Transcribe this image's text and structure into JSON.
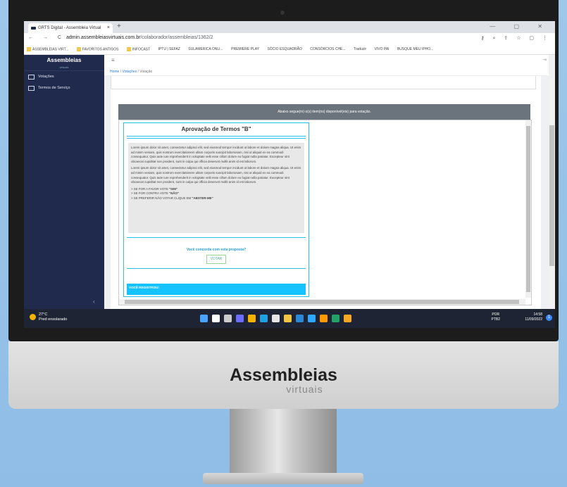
{
  "browser": {
    "tab_title": "GRTS Digital - Assembleia Virtual",
    "tab_close": "×",
    "new_tab": "+",
    "window_controls": "—  ▢  ✕",
    "nav": "← → C",
    "url_domain": "admin.assembleiasvirtuais.com.br",
    "url_path": "/colaborador/assembleias/1362/2",
    "tools": "⚷ ⌕ ⇪ ☆ ▢ ⋮",
    "bookmarks": [
      "ASSEMBLEIAS VIRT...",
      "FAVORITOS ANTIGOS",
      "INFOCAST",
      "IPTU | SEFAZ",
      "SULAMERICA ONLI...",
      "PREMIERE PLAY",
      "SÓCIO ESQUADRÃO",
      "CONSÓRCIOS CHE...",
      "Traduzir",
      "VIVO PAI",
      "BUSQUE MEU IPHO..."
    ]
  },
  "sidebar": {
    "logo": "Assembleias",
    "logo_sub": "virtuais",
    "items": [
      {
        "label": "Votações"
      },
      {
        "label": "Termos de Serviço"
      }
    ],
    "collapse": "‹"
  },
  "topbar": {
    "menu": "≡",
    "logout": "⇥"
  },
  "breadcrumb": {
    "home": "Home",
    "sep": "/",
    "votacoes": "Votações",
    "current": "Votação"
  },
  "notice": "Abaixo segue(m) o(s) item(ns) disponível(eis) para votação.",
  "document": {
    "title": "Aprovação de Termos \"B\"",
    "paragraph1": "Lorem ipsum dolor sit amet, consectetur adipisci elit, sed eiusmod tempor incidunt ut labore et dolore magna aliqua. Ut enim ad minim veniam, quis nostrum exercitationem ullam corporis suscipit laboriosam, nisi ut aliquid ex ea commodi consequatur. Quis aute iure reprehenderit in voluptate velit esse cillum dolore eu fugiat nulla pariatur. Excepteur sint obcaecat cupiditat non proident, sunt in culpa qui officia deserunt mollit anim id est laborum.",
    "paragraph2": "Lorem ipsum dolor sit amet, consectetur adipisci elit, sed eiusmod tempor incidunt ut labore et dolore magna aliqua. Ut enim ad minim veniam, quis nostrum exercitationem ullam corporis suscipit laboriosam, nisi ut aliquid ex ea commodi consequatur. Quis aute iure reprehenderit in voluptate velit esse cillum dolore eu fugiat nulla pariatur. Excepteur sint obcaecat cupiditat non proident, sunt in culpa qui officia deserunt mollit anim id est laborum.",
    "vote_yes_prefix": "> SE FOR A FAVOR VOTE ",
    "vote_yes": "\"SIM\"",
    "vote_no_prefix": "> SE FOR CONTRA VOTE ",
    "vote_no": "\"NÃO\"",
    "vote_abstain_prefix": "> SE PREFERIR NÃO VOTAR CLIQUE EM ",
    "vote_abstain": "\"ABSTER-ME\"",
    "question": "Você concorda com esta proposta?",
    "vote_button": "VOTAR",
    "registered": "VOCÊ REGISTROU:"
  },
  "taskbar": {
    "temp": "27°C",
    "weather": "Pred ensolarado",
    "lang1": "POR",
    "lang2": "PTB2",
    "time": "14:58",
    "date": "11/09/2022",
    "icons": [
      "windows-icon",
      "search-icon",
      "taskview-icon",
      "chat-icon",
      "chrome-icon",
      "edge-icon",
      "store-icon",
      "explorer-icon",
      "mail-icon",
      "photoshop-icon",
      "illustrator-icon",
      "excel-icon",
      "photos-icon"
    ],
    "icon_colors": [
      "#4aa3ff",
      "#ffffff",
      "#cccccc",
      "#6c6cff",
      "#f4b400",
      "#1fa0e0",
      "#e6e6e6",
      "#f4c542",
      "#2b88d8",
      "#31a8ff",
      "#ff9a00",
      "#21a366",
      "#f5a623"
    ]
  },
  "device": {
    "brand": "Assembleias",
    "brand_sub": "virtuais"
  }
}
